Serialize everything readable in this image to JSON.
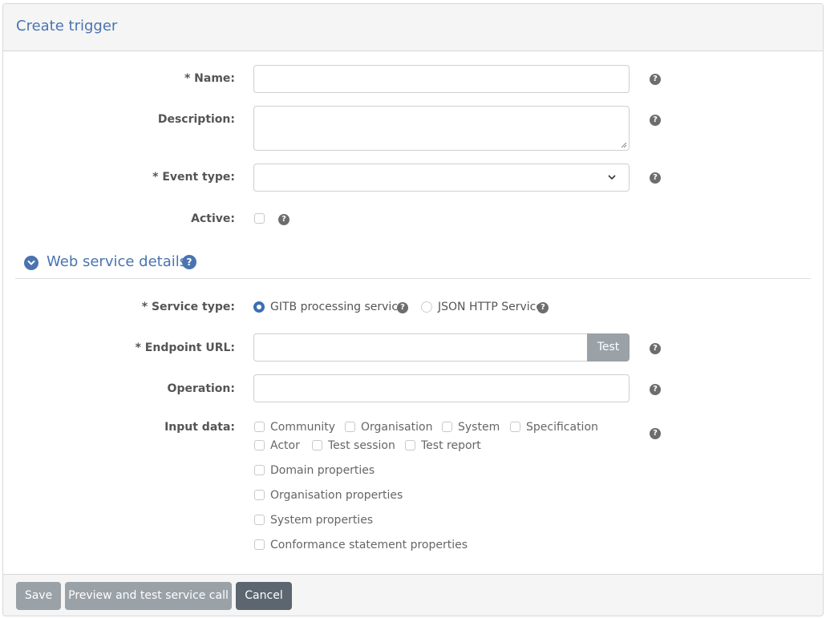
{
  "header": {
    "title": "Create trigger"
  },
  "form": {
    "name_label": "* Name:",
    "name_value": "",
    "description_label": "Description:",
    "description_value": "",
    "event_type_label": "* Event type:",
    "event_type_value": "",
    "active_label": "Active:"
  },
  "web_service": {
    "title": "Web service details",
    "service_type_label": "* Service type:",
    "service_types": [
      {
        "label": "GITB processing service",
        "selected": true
      },
      {
        "label": "JSON HTTP Service",
        "selected": false
      }
    ],
    "endpoint_label": "* Endpoint URL:",
    "endpoint_value": "",
    "test_button": "Test",
    "operation_label": "Operation:",
    "operation_value": "",
    "input_data_label": "Input data:",
    "input_data_options": [
      "Community",
      "Organisation",
      "System",
      "Specification",
      "Actor",
      "Test session",
      "Test report",
      "Domain properties",
      "Organisation properties",
      "System properties",
      "Conformance statement properties"
    ]
  },
  "help_glyph": "?",
  "footer": {
    "save": "Save",
    "preview": "Preview and test service call",
    "cancel": "Cancel"
  },
  "colors": {
    "accent": "#4a74b0",
    "radio_selected": "#3a6fb3",
    "button_disabled": "#9aa1a7",
    "button_cancel": "#5c6670"
  }
}
